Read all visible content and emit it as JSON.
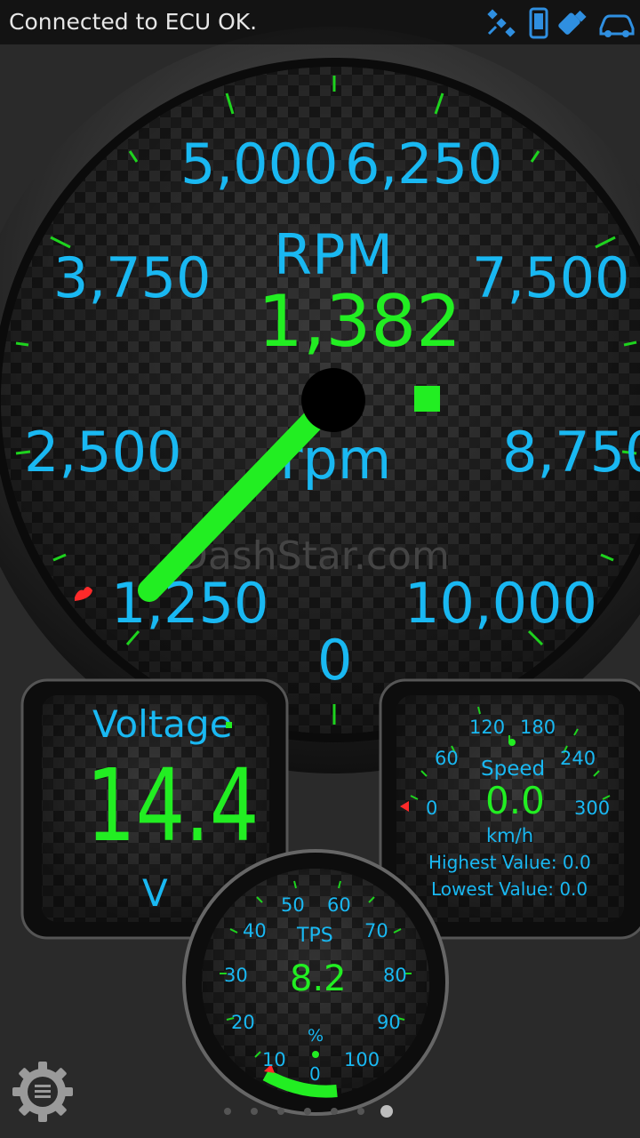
{
  "status_bar": {
    "message": "Connected to ECU OK.",
    "icons": [
      "satellite-icon",
      "phone-icon",
      "usb-icon",
      "car-icon"
    ]
  },
  "rpm_gauge": {
    "title": "RPM",
    "value": "1,382",
    "unit": "rpm",
    "tick_labels": [
      "0",
      "1,250",
      "2,500",
      "3,750",
      "5,000",
      "6,250",
      "7,500",
      "8,750",
      "10,000"
    ],
    "watermark": "DashStar.com"
  },
  "voltage_gauge": {
    "title": "Voltage",
    "value": "14.4",
    "unit": "V"
  },
  "speed_gauge": {
    "title": "Speed",
    "value": "0.0",
    "unit": "km/h",
    "tick_labels": [
      "0",
      "60",
      "120",
      "180",
      "240",
      "300"
    ],
    "highest": "Highest Value: 0.0",
    "lowest": "Lowest Value: 0.0"
  },
  "tps_gauge": {
    "title": "TPS",
    "value": "8.2",
    "unit": "%",
    "tick_labels": [
      "0",
      "10",
      "20",
      "30",
      "40",
      "50",
      "60",
      "70",
      "80",
      "90",
      "100"
    ]
  },
  "pager": {
    "count": 7,
    "active": 6
  },
  "colors": {
    "accent_cyan": "#19b8f2",
    "accent_green": "#22ee22",
    "marker_red": "#ff2a2a"
  },
  "menu": {
    "icon": "gear-menu-icon"
  }
}
